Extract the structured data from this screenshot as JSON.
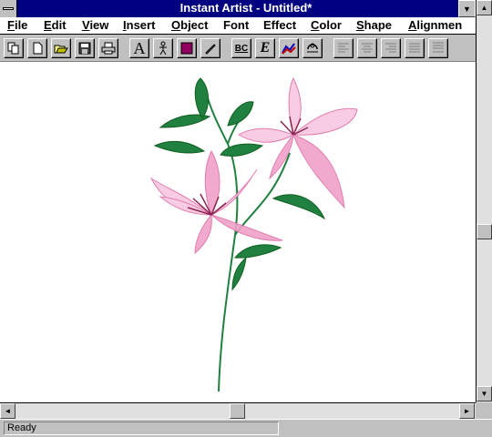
{
  "window": {
    "title": "Instant Artist - Untitled*",
    "minimize_glyph": "▼",
    "maximize_glyph": "▲"
  },
  "menu": [
    {
      "first": "F",
      "rest": "ile"
    },
    {
      "first": "E",
      "rest": "dit"
    },
    {
      "first": "V",
      "rest": "iew"
    },
    {
      "first": "I",
      "rest": "nsert"
    },
    {
      "first": "O",
      "rest": "bject"
    },
    {
      "first": "Fo",
      "rest": "nt",
      "mn_index": 1
    },
    {
      "first": "Eff",
      "rest": "ect"
    },
    {
      "first": "C",
      "rest": "olor"
    },
    {
      "first": "S",
      "rest": "hape"
    },
    {
      "first": "A",
      "rest": "lignmen"
    }
  ],
  "toolbar": {
    "buttons": [
      "copy-icon",
      "new-icon",
      "open-icon",
      "save-icon",
      "print-icon",
      "text-icon",
      "clipart-icon",
      "color-fill-icon",
      "pen-icon",
      "spell-check-icon",
      "special-text-icon",
      "chart-icon",
      "shape-effect-icon",
      "align-left-icon",
      "align-center-icon",
      "align-right-icon",
      "justify-icon",
      "stretch-icon"
    ],
    "text_label": "A",
    "spell_label": "BC",
    "special_label": "E"
  },
  "scroll": {
    "up": "▲",
    "down": "▼",
    "left": "◄",
    "right": "►"
  },
  "status": {
    "text": "Ready"
  },
  "colors": {
    "title_bg": "#000080",
    "petal_pink": "#f0a0c8",
    "leaf_green": "#208040"
  }
}
